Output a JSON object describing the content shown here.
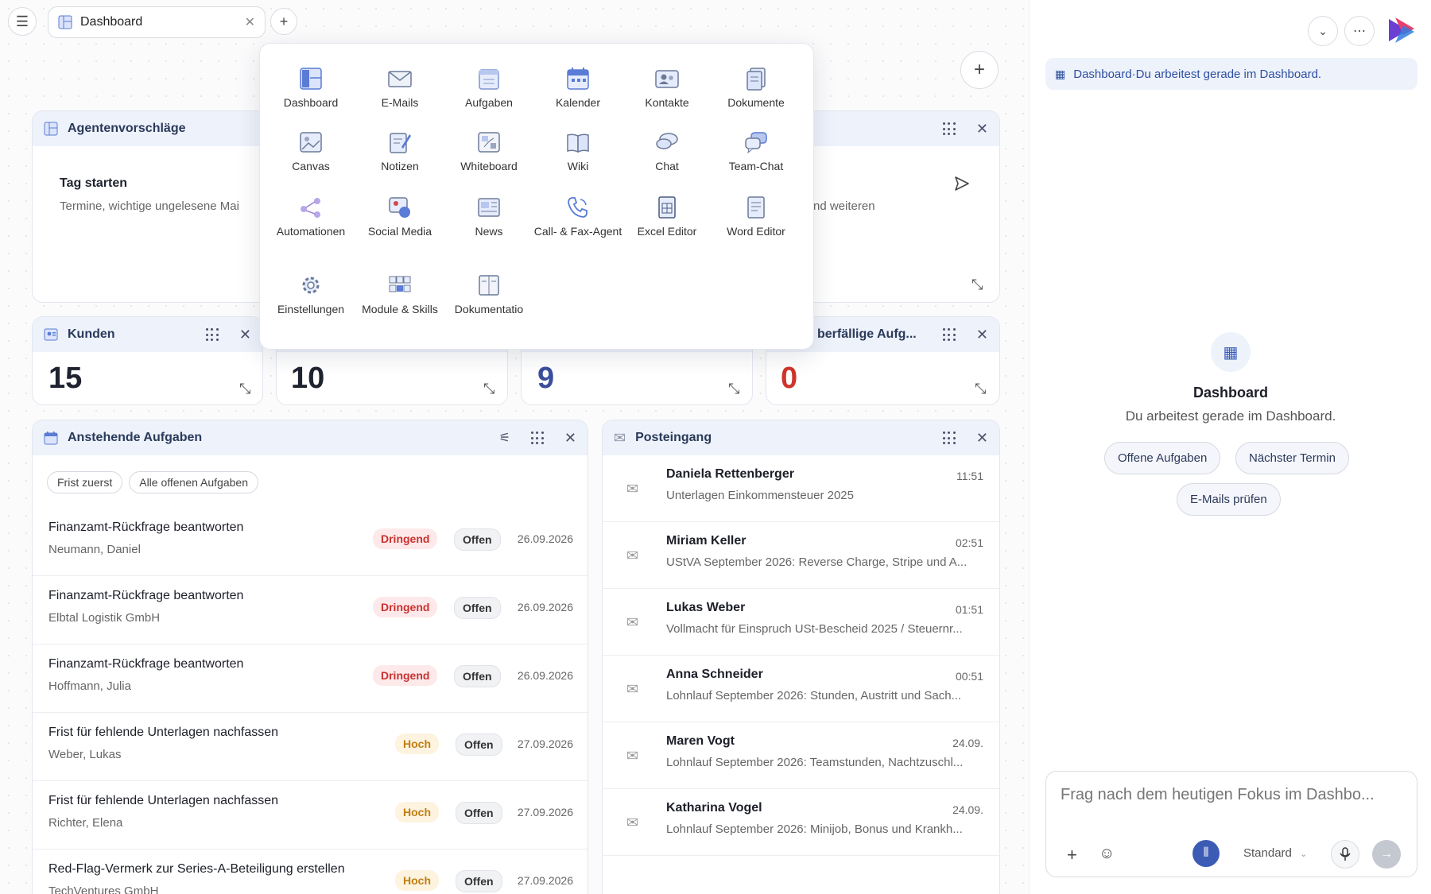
{
  "topbar": {
    "tab_label": "Dashboard"
  },
  "apps": [
    {
      "label": "Dashboard",
      "icon": "dashboard-icon"
    },
    {
      "label": "E-Mails",
      "icon": "mail-icon"
    },
    {
      "label": "Aufgaben",
      "icon": "tasks-icon"
    },
    {
      "label": "Kalender",
      "icon": "calendar-icon"
    },
    {
      "label": "Kontakte",
      "icon": "contacts-icon"
    },
    {
      "label": "Dokumente",
      "icon": "documents-icon"
    },
    {
      "label": "Canvas",
      "icon": "canvas-icon"
    },
    {
      "label": "Notizen",
      "icon": "notes-icon"
    },
    {
      "label": "Whiteboard",
      "icon": "whiteboard-icon"
    },
    {
      "label": "Wiki",
      "icon": "wiki-icon"
    },
    {
      "label": "Chat",
      "icon": "chat-icon"
    },
    {
      "label": "Team-Chat",
      "icon": "team-chat-icon"
    },
    {
      "label": "Automationen",
      "icon": "automation-icon"
    },
    {
      "label": "Social Media",
      "icon": "social-media-icon"
    },
    {
      "label": "News",
      "icon": "news-icon"
    },
    {
      "label": "Call- & Fax-Agent",
      "icon": "phone-icon"
    },
    {
      "label": "Excel Editor",
      "icon": "excel-icon"
    },
    {
      "label": "Word Editor",
      "icon": "word-icon"
    },
    {
      "label": "Einstellungen",
      "icon": "settings-icon"
    },
    {
      "label": "Module & Skills",
      "icon": "modules-icon"
    },
    {
      "label": "Dokumentatio",
      "icon": "docs-icon"
    }
  ],
  "agent_widget": {
    "title": "Agentenvorschläge",
    "card_title": "Tag starten",
    "card_text": "Termine, wichtige ungelesene Mai",
    "card_text_right": "nd weiteren"
  },
  "stats": [
    {
      "title": "Kunden",
      "value": "15",
      "color": "#1f2330"
    },
    {
      "title": "",
      "value": "10",
      "color": "#1f2330"
    },
    {
      "title": "",
      "value": "9",
      "color": "#3a4e9c"
    },
    {
      "title": "berfällige Aufg...",
      "value": "0",
      "color": "#d0342c"
    }
  ],
  "tasks_widget": {
    "title": "Anstehende Aufgaben",
    "filters": [
      "Frist zuerst",
      "Alle offenen Aufgaben"
    ],
    "rows": [
      {
        "title": "Finanzamt-Rückfrage beantworten",
        "client": "Neumann, Daniel",
        "priority": "Dringend",
        "status": "Offen",
        "date": "26.09.2026"
      },
      {
        "title": "Finanzamt-Rückfrage beantworten",
        "client": "Elbtal Logistik GmbH",
        "priority": "Dringend",
        "status": "Offen",
        "date": "26.09.2026"
      },
      {
        "title": "Finanzamt-Rückfrage beantworten",
        "client": "Hoffmann, Julia",
        "priority": "Dringend",
        "status": "Offen",
        "date": "26.09.2026"
      },
      {
        "title": "Frist für fehlende Unterlagen nachfassen",
        "client": "Weber, Lukas",
        "priority": "Hoch",
        "status": "Offen",
        "date": "27.09.2026"
      },
      {
        "title": "Frist für fehlende Unterlagen nachfassen",
        "client": "Richter, Elena",
        "priority": "Hoch",
        "status": "Offen",
        "date": "27.09.2026"
      },
      {
        "title": "Red-Flag-Vermerk zur Series-A-Beteiligung erstellen",
        "client": "TechVentures GmbH",
        "priority": "Hoch",
        "status": "Offen",
        "date": "27.09.2026"
      }
    ]
  },
  "inbox_widget": {
    "title": "Posteingang",
    "mails": [
      {
        "from": "Daniela Rettenberger",
        "subject": "Unterlagen Einkommensteuer 2025",
        "time": "11:51"
      },
      {
        "from": "Miriam Keller",
        "subject": "UStVA September 2026: Reverse Charge, Stripe und A...",
        "time": "02:51"
      },
      {
        "from": "Lukas Weber",
        "subject": "Vollmacht für Einspruch USt-Bescheid 2025 / Steuernr...",
        "time": "01:51"
      },
      {
        "from": "Anna Schneider",
        "subject": "Lohnlauf September 2026: Stunden, Austritt und Sach...",
        "time": "00:51"
      },
      {
        "from": "Maren Vogt",
        "subject": "Lohnlauf September 2026: Teamstunden, Nachtzuschl...",
        "time": "24.09."
      },
      {
        "from": "Katharina Vogel",
        "subject": "Lohnlauf September 2026: Minijob, Bonus und Krankh...",
        "time": "24.09."
      }
    ]
  },
  "assistant": {
    "context_label": "Dashboard",
    "context_sep": " · ",
    "context_text": "Du arbeitest gerade im Dashboard.",
    "center_title": "Dashboard",
    "center_text": "Du arbeitest gerade im Dashboard.",
    "suggestions": [
      "Offene Aufgaben",
      "Nächster Termin",
      "E-Mails prüfen"
    ],
    "input_placeholder": "Frag nach dem heutigen Fokus im Dashbo...",
    "mode": "Standard"
  }
}
